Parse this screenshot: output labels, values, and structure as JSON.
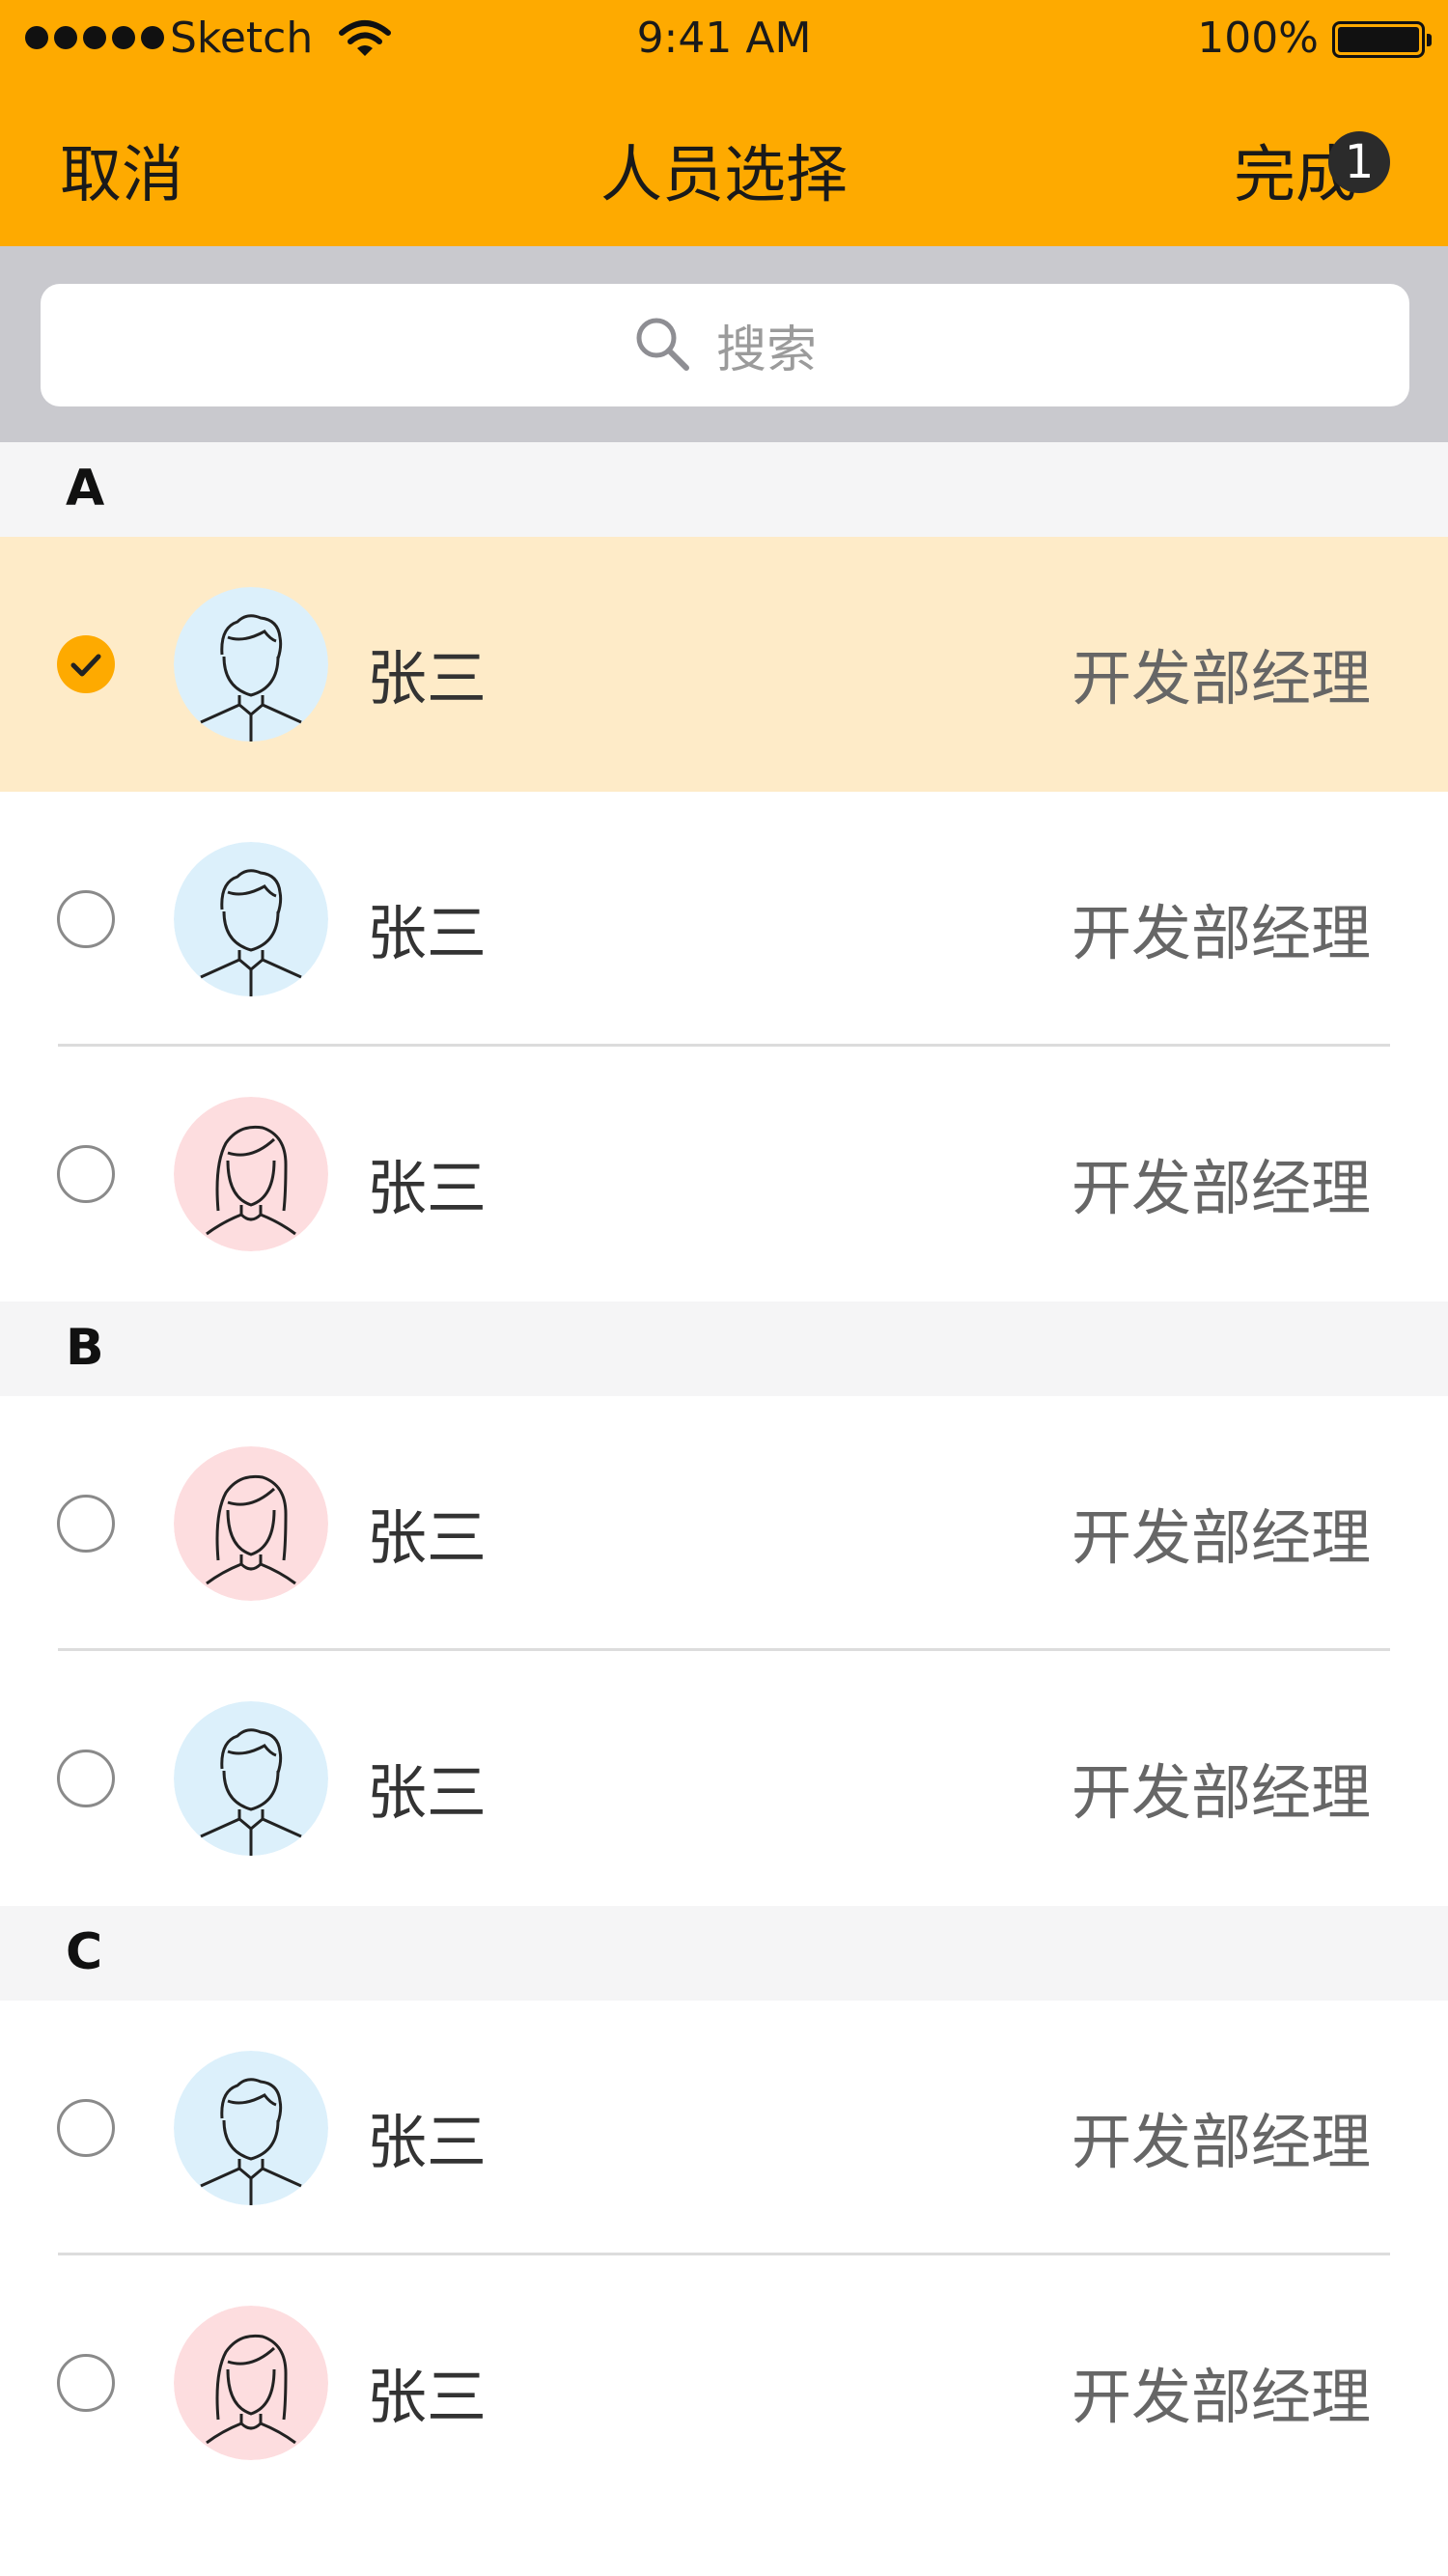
{
  "status": {
    "carrier": "Sketch",
    "time": "9:41 AM",
    "battery": "100%"
  },
  "nav": {
    "cancel": "取消",
    "title": "人员选择",
    "done": "完成",
    "done_count": "1"
  },
  "search": {
    "placeholder": "搜索"
  },
  "sections": [
    {
      "letter": "A",
      "people": [
        {
          "name": "张三",
          "role": "开发部经理",
          "selected": true,
          "gender": "male"
        },
        {
          "name": "张三",
          "role": "开发部经理",
          "selected": false,
          "gender": "male"
        },
        {
          "name": "张三",
          "role": "开发部经理",
          "selected": false,
          "gender": "female"
        }
      ]
    },
    {
      "letter": "B",
      "people": [
        {
          "name": "张三",
          "role": "开发部经理",
          "selected": false,
          "gender": "female"
        },
        {
          "name": "张三",
          "role": "开发部经理",
          "selected": false,
          "gender": "male"
        }
      ]
    },
    {
      "letter": "C",
      "people": [
        {
          "name": "张三",
          "role": "开发部经理",
          "selected": false,
          "gender": "male"
        },
        {
          "name": "张三",
          "role": "开发部经理",
          "selected": false,
          "gender": "female"
        }
      ]
    }
  ],
  "colors": {
    "accent": "#FEAA00",
    "selected_row": "#FEEBC8",
    "male_avatar_bg": "#DCF0FB",
    "female_avatar_bg": "#FDDDDF"
  },
  "icons": {
    "search": "search-icon",
    "check": "checkmark-icon",
    "wifi": "wifi-icon",
    "battery": "battery-icon",
    "male_avatar": "male-avatar-icon",
    "female_avatar": "female-avatar-icon"
  }
}
